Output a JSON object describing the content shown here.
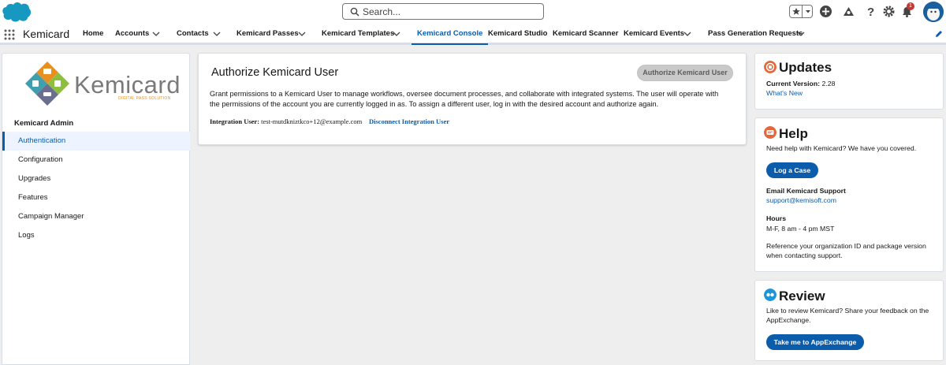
{
  "header": {
    "search_placeholder": "Search...",
    "notification_count": "1"
  },
  "nav": {
    "app_name": "Kemicard",
    "items": [
      {
        "label": "Home"
      },
      {
        "label": "Accounts"
      },
      {
        "label": "Contacts"
      },
      {
        "label": "Kemicard Passes"
      },
      {
        "label": "Kemicard Templates"
      },
      {
        "label": "Kemicard Console"
      },
      {
        "label": "Kemicard Studio"
      },
      {
        "label": "Kemicard Scanner"
      },
      {
        "label": "Kemicard Events"
      },
      {
        "label": "Pass Generation Requests"
      }
    ],
    "active": "Kemicard Console"
  },
  "sidebar": {
    "logo_text": "Kemicard",
    "logo_tagline": "DIGITAL PASS SOLUTION",
    "heading": "Kemicard Admin",
    "items": [
      {
        "label": "Authentication"
      },
      {
        "label": "Configuration"
      },
      {
        "label": "Upgrades"
      },
      {
        "label": "Features"
      },
      {
        "label": "Campaign Manager"
      },
      {
        "label": "Logs"
      }
    ]
  },
  "main": {
    "title": "Authorize Kemicard User",
    "authorize_button": "Authorize Kemicard User",
    "description": "Grant permissions to a Kemicard User to manage workflows, oversee document processes, and collaborate with integrated systems. The user will operate with the permissions of the account you are currently logged in as. To assign a different user, log in with the desired account and authorize again.",
    "integration_label": "Integration User:",
    "integration_value": "test-mutdkniztkco+12@example.com",
    "disconnect_link": "Disconnect Integration User"
  },
  "updates": {
    "title": "Updates",
    "version_label": "Current Version:",
    "version_value": "2.28",
    "whats_new": "What's New"
  },
  "help": {
    "title": "Help",
    "intro": "Need help with Kemicard? We have you covered.",
    "log_case_button": "Log a Case",
    "email_heading": "Email Kemicard Support",
    "email": "support@kemisoft.com",
    "hours_heading": "Hours",
    "hours": "M-F, 8 am - 4 pm MST",
    "reference_note": "Reference your organization ID and package version when contacting support."
  },
  "review": {
    "title": "Review",
    "text": "Like to review Kemicard? Share your feedback on the AppExchange.",
    "button": "Take me to AppExchange"
  },
  "colors": {
    "brand": "#0b5cab",
    "page_bg": "#eeeeee",
    "updates_icon": "#e3673a",
    "help_icon": "#e3673a",
    "review_icon": "#1b96d9"
  }
}
